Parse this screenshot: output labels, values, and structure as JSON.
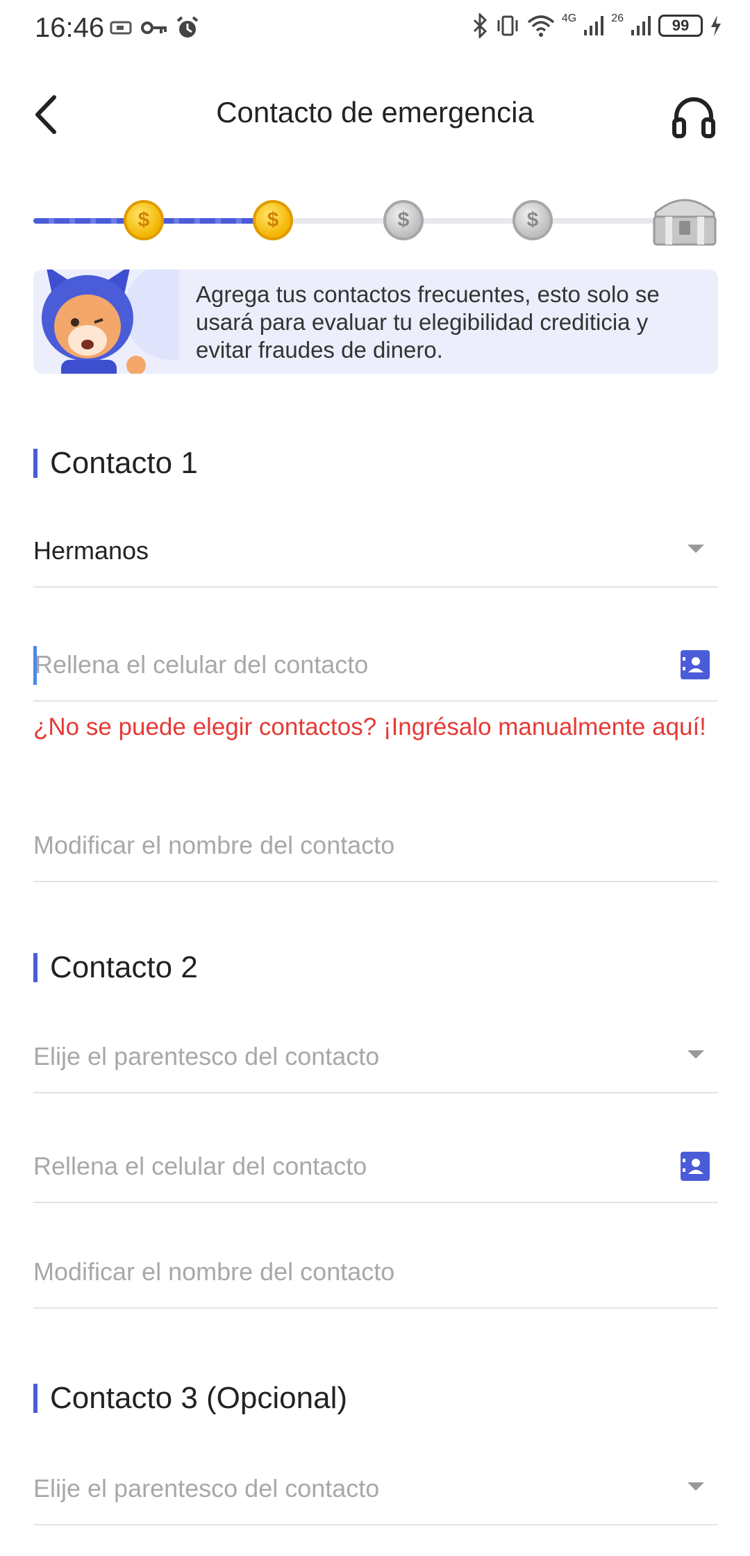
{
  "status_bar": {
    "time": "16:46",
    "network_4g": "4G",
    "network_2g": "26",
    "battery": "99"
  },
  "header": {
    "title": "Contacto de emergencia"
  },
  "progress": {
    "completed_steps": 2,
    "total_steps": 4,
    "coin_symbol": "$"
  },
  "banner": {
    "text": "Agrega tus contactos frecuentes, esto solo se usará para evaluar tu elegibilidad crediticia y evitar fraudes de dinero."
  },
  "contact1": {
    "title": "Contacto 1",
    "relationship_value": "Hermanos",
    "phone_placeholder": "Rellena el celular del contacto",
    "error_text": "¿No se puede elegir contactos? ¡Ingrésalo manualmente aquí!",
    "name_placeholder": "Modificar el nombre del contacto"
  },
  "contact2": {
    "title": "Contacto 2",
    "relationship_placeholder": "Elije el parentesco del contacto",
    "phone_placeholder": "Rellena el celular del contacto",
    "name_placeholder": "Modificar el nombre del contacto"
  },
  "contact3": {
    "title": "Contacto 3 (Opcional)",
    "relationship_placeholder": "Elije el parentesco del contacto"
  },
  "colors": {
    "accent": "#4a5cd8",
    "error": "#e53935",
    "placeholder": "#a8a8a8"
  }
}
